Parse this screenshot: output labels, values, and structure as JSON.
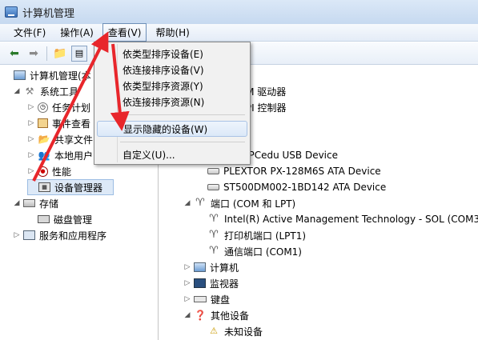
{
  "window": {
    "title": "计算机管理"
  },
  "menubar": {
    "items": [
      "文件(F)",
      "操作(A)",
      "查看(V)",
      "帮助(H)"
    ],
    "active_index": 2
  },
  "dropdown": {
    "group1": [
      "依类型排序设备(E)",
      "依连接排序设备(V)",
      "依类型排序资源(Y)",
      "依连接排序资源(N)"
    ],
    "highlighted": "显示隐藏的设备(W)",
    "group3": [
      "自定义(U)..."
    ]
  },
  "tree": {
    "root": "计算机管理(本地)",
    "root_visible": "计算机管理(本",
    "system_tools": "系统工具",
    "system_tools_children": [
      "任务计划",
      "事件查看",
      "共享文件",
      "本地用户",
      "性能",
      "设备管理器"
    ],
    "system_tools_children_visible": [
      "任务计划",
      "事件查看",
      "共享文件",
      "本地用户",
      "性能",
      "设备管理器"
    ],
    "storage": "存储",
    "disk_mgmt": "磁盘管理",
    "services": "服务和应用程序"
  },
  "devices": {
    "partial": [
      "-ROM 驱动器",
      "ATAPI 控制器",
      "器",
      "line PCedu USB Device"
    ],
    "disk_drives": [
      "PLEXTOR PX-128M6S ATA Device",
      "ST500DM002-1BD142 ATA Device"
    ],
    "ports_category": "端口 (COM 和 LPT)",
    "ports": [
      "Intel(R) Active Management Technology - SOL (COM3)",
      "打印机端口 (LPT1)",
      "通信端口 (COM1)"
    ],
    "categories": [
      "计算机",
      "监视器",
      "键盘",
      "其他设备"
    ],
    "unknown": "未知设备"
  },
  "colors": {
    "arrow": "#e8262b",
    "selection": "#dde9f7"
  }
}
